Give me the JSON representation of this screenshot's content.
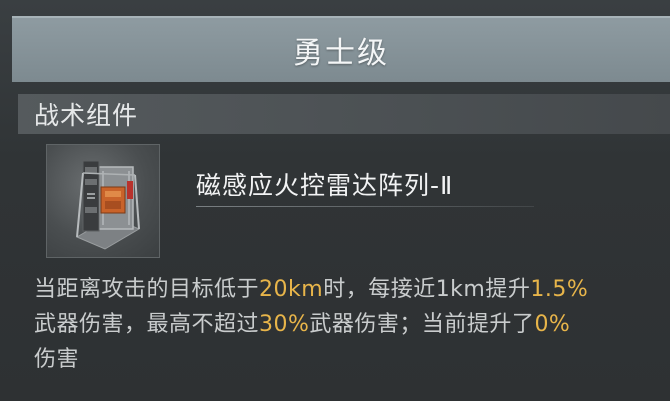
{
  "header": {
    "title": "勇士级"
  },
  "section": {
    "label": "战术组件"
  },
  "item": {
    "icon": "radar-module-icon",
    "name": "磁感应火控雷达阵列-Ⅱ"
  },
  "description": {
    "p1": "当距离攻击的目标低于",
    "v1": "20km",
    "p2": "时，每接近1km提升",
    "v2": "1.5%",
    "p3": "武器伤害，最高不超过",
    "v3": "30%",
    "p4": "武器伤害；当前提升了",
    "v4": "0%",
    "p5": "伤害"
  },
  "colors": {
    "highlight": "#e8b54a",
    "header_bg": "#8e9ba1",
    "section_bg": "#4b5053"
  }
}
